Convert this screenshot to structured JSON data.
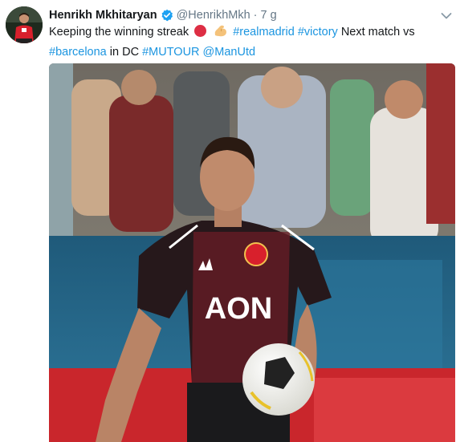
{
  "tweet": {
    "name": "Henrikh Mkhitaryan",
    "handle": "@HenrikhMkh",
    "separator": "·",
    "time": "7 g",
    "text": {
      "t1": "Keeping the winning streak",
      "h1": "#realmadrid",
      "h2": "#victory",
      "t2": "Next match vs",
      "h3": "#barcelona",
      "t3": "in DC",
      "h4": "#MUTOUR",
      "m1": "@ManUtd"
    },
    "photo": {
      "shirt_sponsor": "AON"
    }
  },
  "icons": {
    "verified": "verified-badge-icon",
    "caret": "chevron-down-icon",
    "emoji_circle": "red-circle-emoji",
    "emoji_muscle": "flexed-biceps-emoji"
  },
  "colors": {
    "link": "#1b95e0",
    "secondary_text": "#657786",
    "primary_text": "#14171a",
    "verified": "#1da1f2"
  }
}
